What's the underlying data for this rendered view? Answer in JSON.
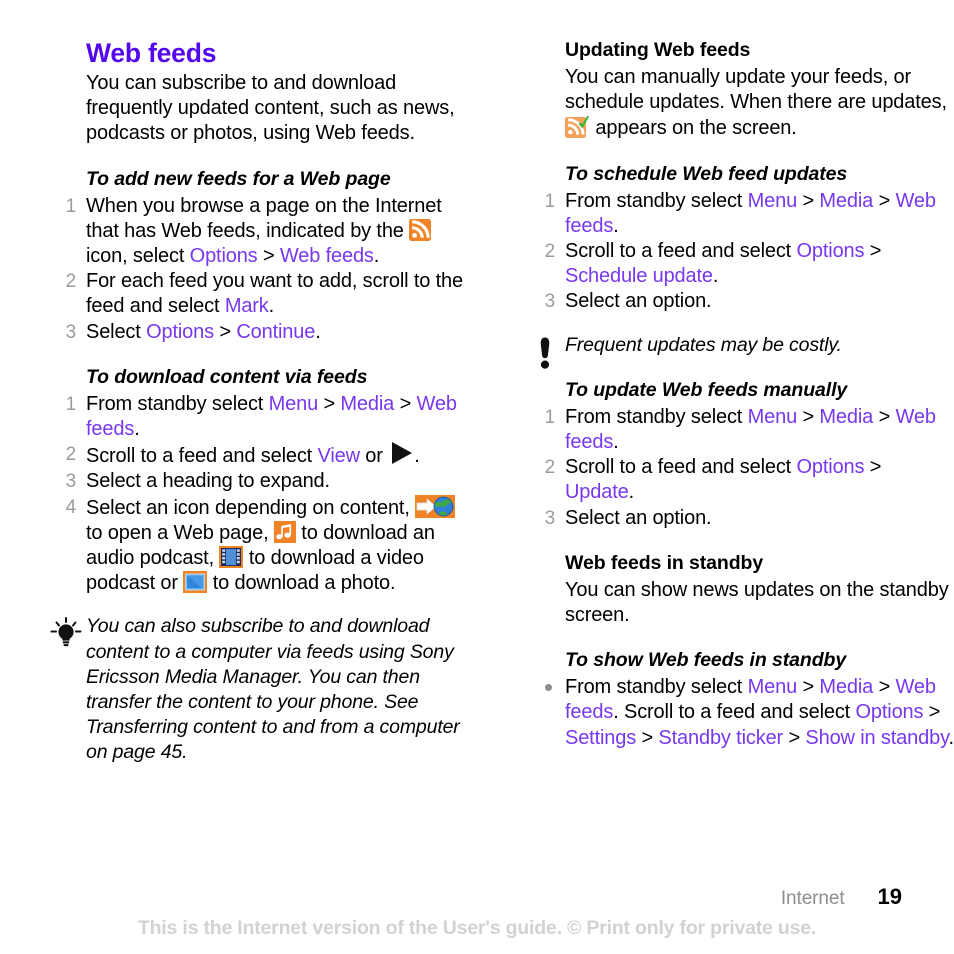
{
  "document": {
    "page_number": "19",
    "chapter": "Internet",
    "watermark": "This is the Internet version of the User's guide. © Print only for private use."
  },
  "left_column": {
    "title": "Web feeds",
    "intro": "You can subscribe to and download frequently updated content, such as news, podcasts or photos, using Web feeds.",
    "add_feeds": {
      "heading": "To add new feeds for a Web page",
      "steps": [
        {
          "num": "1",
          "parts": [
            {
              "t": "When you browse a page on the Internet that has Web feeds, indicated by the ",
              "k": "plain"
            },
            {
              "t": "rss-icon",
              "k": "icon"
            },
            {
              "t": " icon, select ",
              "k": "plain"
            },
            {
              "t": "Options",
              "k": "link"
            },
            {
              "t": " > ",
              "k": "plain"
            },
            {
              "t": "Web feeds",
              "k": "link"
            },
            {
              "t": ".",
              "k": "plain"
            }
          ]
        },
        {
          "num": "2",
          "parts": [
            {
              "t": "For each feed you want to add, scroll to the feed and select ",
              "k": "plain"
            },
            {
              "t": "Mark",
              "k": "link"
            },
            {
              "t": ".",
              "k": "plain"
            }
          ]
        },
        {
          "num": "3",
          "parts": [
            {
              "t": "Select ",
              "k": "plain"
            },
            {
              "t": "Options",
              "k": "link"
            },
            {
              "t": " > ",
              "k": "plain"
            },
            {
              "t": "Continue",
              "k": "link"
            },
            {
              "t": ".",
              "k": "plain"
            }
          ]
        }
      ]
    },
    "download_feeds": {
      "heading": "To download content via feeds",
      "steps": [
        {
          "num": "1",
          "parts": [
            {
              "t": "From standby select ",
              "k": "plain"
            },
            {
              "t": "Menu",
              "k": "link"
            },
            {
              "t": " > ",
              "k": "plain"
            },
            {
              "t": "Media",
              "k": "link"
            },
            {
              "t": " > ",
              "k": "plain"
            },
            {
              "t": "Web feeds",
              "k": "link"
            },
            {
              "t": ".",
              "k": "plain"
            }
          ]
        },
        {
          "num": "2",
          "parts": [
            {
              "t": "Scroll to a feed and select ",
              "k": "plain"
            },
            {
              "t": "View",
              "k": "link"
            },
            {
              "t": " or ",
              "k": "plain"
            },
            {
              "t": "play-triangle-icon",
              "k": "icon"
            },
            {
              "t": ".",
              "k": "plain"
            }
          ]
        },
        {
          "num": "3",
          "parts": [
            {
              "t": "Select a heading to expand.",
              "k": "plain"
            }
          ]
        },
        {
          "num": "4",
          "parts": [
            {
              "t": "Select an icon depending on content, ",
              "k": "plain"
            },
            {
              "t": "web-page-icon",
              "k": "icon"
            },
            {
              "t": " to open a Web page, ",
              "k": "plain"
            },
            {
              "t": "music-note-icon",
              "k": "icon"
            },
            {
              "t": " to download an audio podcast, ",
              "k": "plain"
            },
            {
              "t": "film-strip-icon",
              "k": "icon"
            },
            {
              "t": " to download a video podcast or ",
              "k": "plain"
            },
            {
              "t": "photo-icon",
              "k": "icon"
            },
            {
              "t": " to download a photo.",
              "k": "plain"
            }
          ]
        }
      ]
    },
    "tip": {
      "icon": "lightbulb-icon",
      "text": "You can also subscribe to and download content to a computer via feeds using Sony Ericsson Media Manager. You can then transfer the content to your phone. See Transferring content to and from a computer on page 45."
    }
  },
  "right_column": {
    "updating": {
      "heading": "Updating Web feeds",
      "paragraph_parts": [
        {
          "t": "You can manually update your feeds, or schedule updates. When there are updates, ",
          "k": "plain"
        },
        {
          "t": "rss-update-icon",
          "k": "icon"
        },
        {
          "t": " appears on the screen.",
          "k": "plain"
        }
      ]
    },
    "schedule": {
      "heading": "To schedule Web feed updates",
      "steps": [
        {
          "num": "1",
          "parts": [
            {
              "t": "From standby select ",
              "k": "plain"
            },
            {
              "t": "Menu",
              "k": "link"
            },
            {
              "t": " > ",
              "k": "plain"
            },
            {
              "t": "Media",
              "k": "link"
            },
            {
              "t": " > ",
              "k": "plain"
            },
            {
              "t": "Web feeds",
              "k": "link"
            },
            {
              "t": ".",
              "k": "plain"
            }
          ]
        },
        {
          "num": "2",
          "parts": [
            {
              "t": "Scroll to a feed and select ",
              "k": "plain"
            },
            {
              "t": "Options",
              "k": "link"
            },
            {
              "t": " > ",
              "k": "plain"
            },
            {
              "t": "Schedule update",
              "k": "link"
            },
            {
              "t": ".",
              "k": "plain"
            }
          ]
        },
        {
          "num": "3",
          "parts": [
            {
              "t": "Select an option.",
              "k": "plain"
            }
          ]
        }
      ]
    },
    "note": {
      "icon": "exclamation-icon",
      "text": "Frequent updates may be costly."
    },
    "manual_update": {
      "heading": "To update Web feeds manually",
      "steps": [
        {
          "num": "1",
          "parts": [
            {
              "t": "From standby select ",
              "k": "plain"
            },
            {
              "t": "Menu",
              "k": "link"
            },
            {
              "t": " > ",
              "k": "plain"
            },
            {
              "t": "Media",
              "k": "link"
            },
            {
              "t": " > ",
              "k": "plain"
            },
            {
              "t": "Web feeds",
              "k": "link"
            },
            {
              "t": ".",
              "k": "plain"
            }
          ]
        },
        {
          "num": "2",
          "parts": [
            {
              "t": "Scroll to a feed and select ",
              "k": "plain"
            },
            {
              "t": "Options",
              "k": "link"
            },
            {
              "t": " > ",
              "k": "plain"
            },
            {
              "t": "Update",
              "k": "link"
            },
            {
              "t": ".",
              "k": "plain"
            }
          ]
        },
        {
          "num": "3",
          "parts": [
            {
              "t": "Select an option.",
              "k": "plain"
            }
          ]
        }
      ]
    },
    "standby": {
      "heading": "Web feeds in standby",
      "paragraph": "You can show news updates on the standby screen."
    },
    "show_standby": {
      "heading": "To show Web feeds in standby",
      "steps": [
        {
          "num": "•",
          "parts": [
            {
              "t": "From standby select ",
              "k": "plain"
            },
            {
              "t": "Menu",
              "k": "link"
            },
            {
              "t": " > ",
              "k": "plain"
            },
            {
              "t": "Media",
              "k": "link"
            },
            {
              "t": " > ",
              "k": "plain"
            },
            {
              "t": "Web feeds",
              "k": "link"
            },
            {
              "t": ". Scroll to a feed and select ",
              "k": "plain"
            },
            {
              "t": "Options",
              "k": "link"
            },
            {
              "t": " > ",
              "k": "plain"
            },
            {
              "t": "Settings",
              "k": "link"
            },
            {
              "t": " > ",
              "k": "plain"
            },
            {
              "t": "Standby ticker",
              "k": "link"
            },
            {
              "t": " > ",
              "k": "plain"
            },
            {
              "t": "Show in standby",
              "k": "link"
            },
            {
              "t": ".",
              "k": "plain"
            }
          ]
        }
      ]
    }
  },
  "colors": {
    "title": "#5408ef",
    "link": "#7738ef",
    "step_number": "#9b9b9b",
    "watermark": "#d2d2d2",
    "chapter": "#8d8d8d",
    "icon_orange": "#f08326"
  }
}
